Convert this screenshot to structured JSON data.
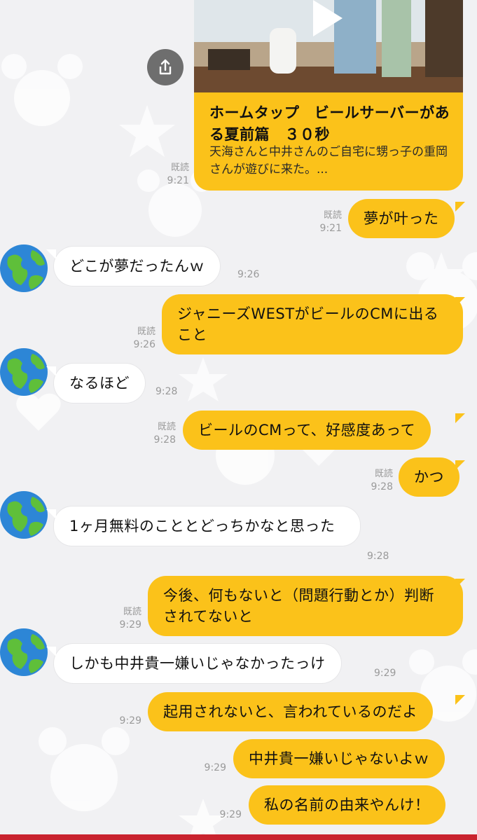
{
  "colors": {
    "background": "#f1f1f3",
    "my_bubble": "#fbc21a",
    "their_bubble": "#ffffff",
    "meta_text": "#9a9a9a",
    "bottom_bar": "#c9232e"
  },
  "preview": {
    "title": "ホームタップ　ビールサーバーがある夏前篇　３０秒",
    "description": "天海さんと中井さんのご自宅に甥っ子の重岡さんが遊びに来た。...",
    "read": "既読",
    "time": "9:21",
    "share_icon": "share-icon",
    "play_icon": "play-icon"
  },
  "messages": [
    {
      "sender": "me",
      "text": "夢が叶った",
      "read": "既読",
      "time": "9:21"
    },
    {
      "sender": "them",
      "text": "どこが夢だったんｗ",
      "time": "9:26"
    },
    {
      "sender": "me",
      "text": "ジャニーズWESTがビールのCMに出ること",
      "read": "既読",
      "time": "9:26"
    },
    {
      "sender": "them",
      "text": "なるほど",
      "time": "9:28"
    },
    {
      "sender": "me",
      "text": "ビールのCMって、好感度あって",
      "read": "既読",
      "time": "9:28"
    },
    {
      "sender": "me",
      "text": "かつ",
      "read": "既読",
      "time": "9:28"
    },
    {
      "sender": "them",
      "text": "1ヶ月無料のこととどっちかなと思った",
      "time": "9:28"
    },
    {
      "sender": "me",
      "text": "今後、何もないと（問題行動とか）判断されてないと",
      "read": "既読",
      "time": "9:29"
    },
    {
      "sender": "them",
      "text": "しかも中井貴一嫌いじゃなかったっけ",
      "time": "9:29"
    },
    {
      "sender": "me",
      "text": "起用されないと、言われているのだよ",
      "time": "9:29"
    },
    {
      "sender": "me",
      "text": "中井貴一嫌いじゃないよｗ",
      "time": "9:29"
    },
    {
      "sender": "me",
      "text": "私の名前の由来やんけ！",
      "time": "9:29"
    }
  ],
  "avatar_icon": "globe-icon"
}
